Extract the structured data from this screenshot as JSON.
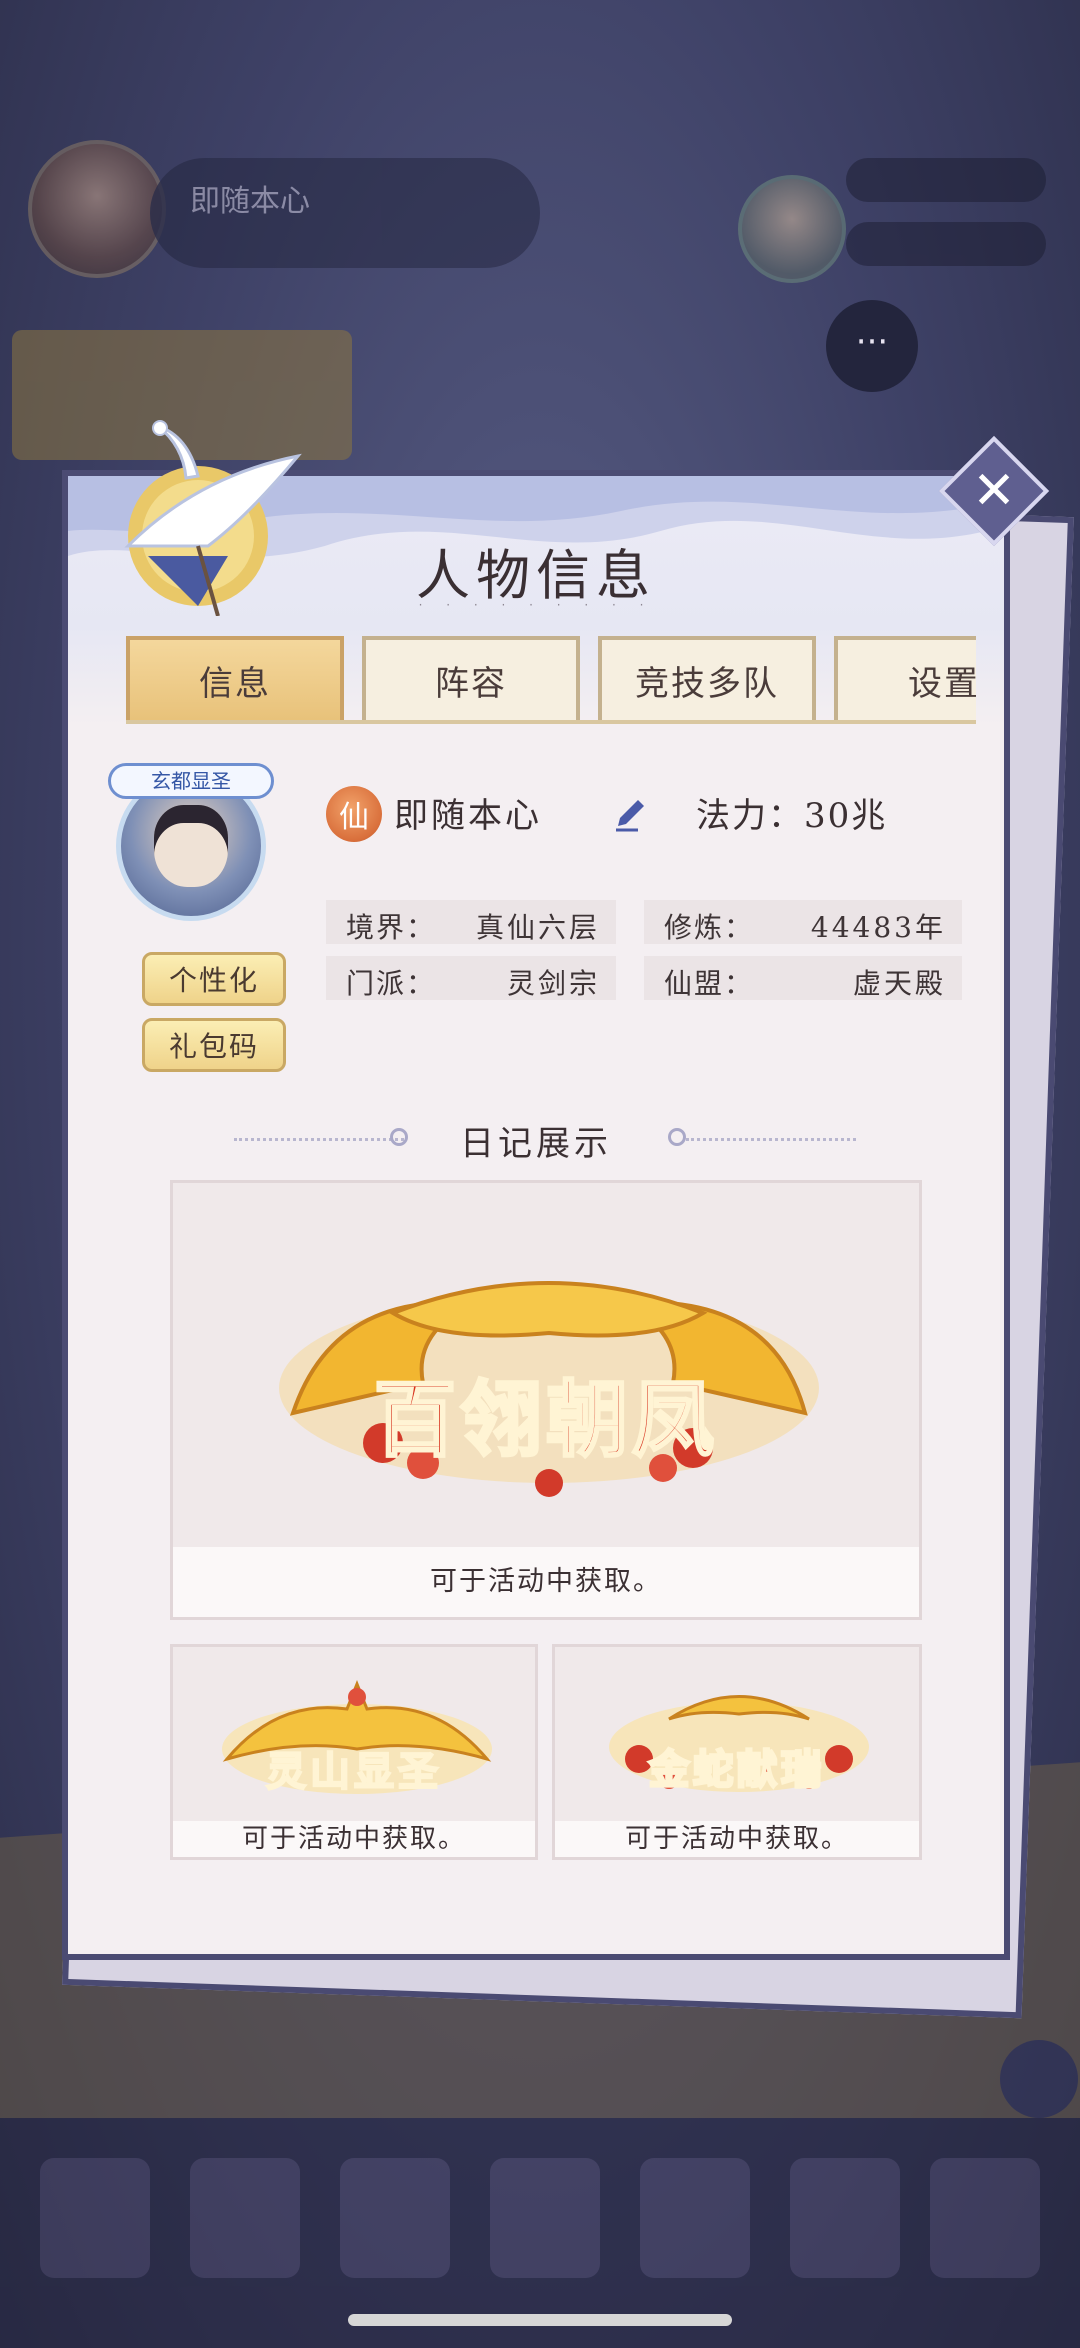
{
  "modal": {
    "title": "人物信息",
    "close_label": "✕",
    "tabs": [
      {
        "label": "信息",
        "active": true
      },
      {
        "label": "阵容",
        "active": false
      },
      {
        "label": "竞技多队",
        "active": false
      },
      {
        "label": "设置",
        "active": false
      }
    ]
  },
  "profile": {
    "avatar_badge": "玄都显圣",
    "rank_icon_char": "仙",
    "name": "即随本心",
    "power_label": "法力：",
    "power_value": "30兆",
    "buttons": {
      "personalize": "个性化",
      "gift_code": "礼包码"
    },
    "stats": [
      {
        "label": "境界：",
        "value": "真仙六层"
      },
      {
        "label": "修炼：",
        "value": "44483年"
      },
      {
        "label": "门派：",
        "value": "灵剑宗"
      },
      {
        "label": "仙盟：",
        "value": "虚天殿"
      }
    ]
  },
  "diary": {
    "title": "日记展示",
    "cards": [
      {
        "emblem": "百翎朝凤",
        "caption": "可于活动中获取。"
      },
      {
        "emblem": "灵山显圣",
        "caption": "可于活动中获取。"
      },
      {
        "emblem": "金蛇献瑞",
        "caption": "可于活动中获取。"
      }
    ]
  },
  "background": {
    "player_name": "即随本心"
  },
  "colors": {
    "modal_border": "#4b4b73",
    "tab_active": "#e8c27a",
    "emblem_red": "#d8341f",
    "emblem_gold": "#f2b630"
  }
}
